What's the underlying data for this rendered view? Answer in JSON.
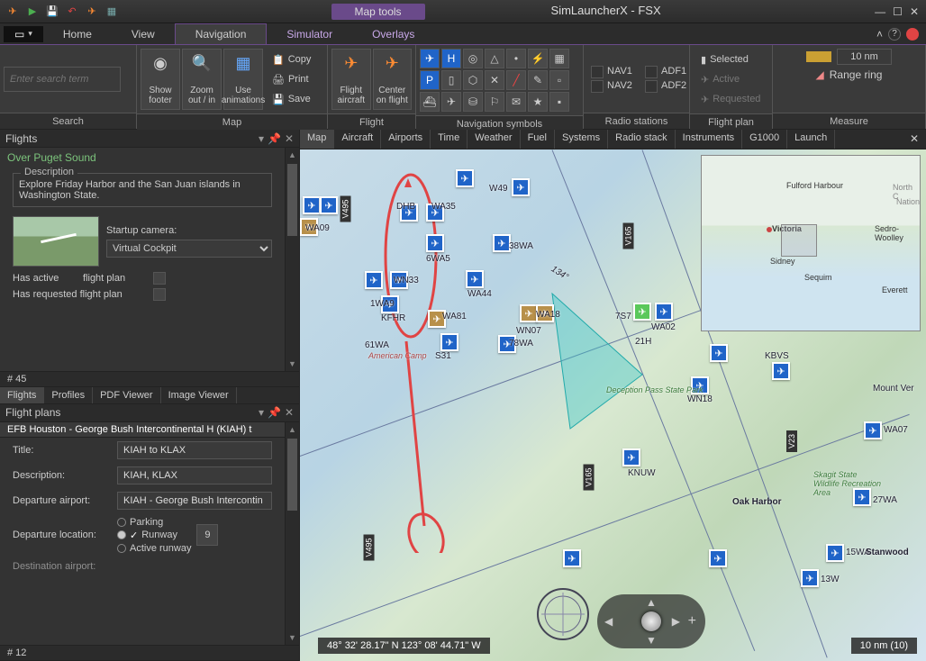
{
  "toolbar": {
    "map_tools": "Map tools",
    "app_title": "SimLauncherX - FSX"
  },
  "menu": {
    "home": "Home",
    "view": "View",
    "navigation": "Navigation",
    "simulator": "Simulator",
    "overlays": "Overlays"
  },
  "ribbon": {
    "search": {
      "placeholder": "Enter search term",
      "label": "Search"
    },
    "map": {
      "show_footer": "Show footer",
      "zoom": "Zoom out / in",
      "anim": "Use animations",
      "copy": "Copy",
      "print": "Print",
      "save": "Save",
      "label": "Map"
    },
    "flight": {
      "flight_aircraft": "Flight aircraft",
      "center": "Center on flight",
      "label": "Flight"
    },
    "navsym": {
      "label": "Navigation symbols"
    },
    "radio": {
      "nav1": "NAV1",
      "adf1": "ADF1",
      "nav2": "NAV2",
      "adf2": "ADF2",
      "label": "Radio stations"
    },
    "fplan": {
      "selected": "Selected",
      "active": "Active",
      "requested": "Requested",
      "label": "Flight plan"
    },
    "measure": {
      "range": "10 nm",
      "ring": "Range ring",
      "label": "Measure"
    }
  },
  "flights": {
    "header": "Flights",
    "name": "Over Puget Sound",
    "desc_label": "Description",
    "desc": "Explore Friday Harbor and the San Juan islands in Washington State.",
    "camera_label": "Startup camera:",
    "camera": "Virtual Cockpit",
    "has_active": "Has active",
    "fp": "flight plan",
    "has_req": "Has requested flight plan",
    "count": "# 45"
  },
  "subtabs": {
    "flights": "Flights",
    "profiles": "Profiles",
    "pdf": "PDF Viewer",
    "image": "Image Viewer"
  },
  "fplan": {
    "header": "Flight plans",
    "selected": "EFB Houston - George Bush Intercontinental H (KIAH) t",
    "title_lbl": "Title:",
    "title": "KIAH to KLAX",
    "desc_lbl": "Description:",
    "desc": "KIAH, KLAX",
    "dep_apt_lbl": "Departure airport:",
    "dep_apt": "KIAH - George Bush Intercontin",
    "dep_loc_lbl": "Departure location:",
    "parking": "Parking",
    "runway": "Runway",
    "active_rwy": "Active runway",
    "nine": "9",
    "dest_lbl": "Destination airport:",
    "count": "# 12"
  },
  "maptabs": {
    "map": "Map",
    "aircraft": "Aircraft",
    "airports": "Airports",
    "time": "Time",
    "weather": "Weather",
    "fuel": "Fuel",
    "systems": "Systems",
    "radiostack": "Radio stack",
    "instruments": "Instruments",
    "g1000": "G1000",
    "launch": "Launch"
  },
  "map": {
    "coords": "48° 32' 28.17\" N 123° 08' 44.71\" W",
    "scale": "10 nm (10)",
    "airports": {
      "w49": "W49",
      "dhb": "DHB",
      "wa35": "WA35",
      "wa09": "WA09",
      "6wa5": "6WA5",
      "38wa": "38WA",
      "wn33": "WN33",
      "1wa9": "1WA9",
      "kfhr": "KFHR",
      "wa81": "WA81",
      "wa18": "WA18",
      "wn07": "WN07",
      "78wa": "78WA",
      "61wa": "61WA",
      "s31": "S31",
      "wa44": "WA44",
      "7s7": "7S7",
      "21h": "21H",
      "wa02": "WA02",
      "kbvs": "KBVS",
      "wn18": "WN18",
      "knuw": "KNUW",
      "wa07": "WA07",
      "27wa": "27WA",
      "15wa": "15WA",
      "13w": "13W",
      "american": "American Camp",
      "deception": "Deception Pass State Park",
      "oakharb": "Oak Harbor",
      "stanwood": "Stanwood",
      "mtver": "Mount Ver"
    },
    "victor": {
      "v495a": "V495",
      "v165a": "V165",
      "v165b": "V165",
      "v495b": "V495",
      "v23": "V23"
    },
    "heading": "134°",
    "minimap": {
      "victoria": "Victoria",
      "fulford": "Fulford Harbour",
      "sidney": "Sidney",
      "sedro": "Sedro-Woolley",
      "sequim": "Sequim",
      "everett": "Everett",
      "north": "North C",
      "nation": "Nation"
    }
  }
}
